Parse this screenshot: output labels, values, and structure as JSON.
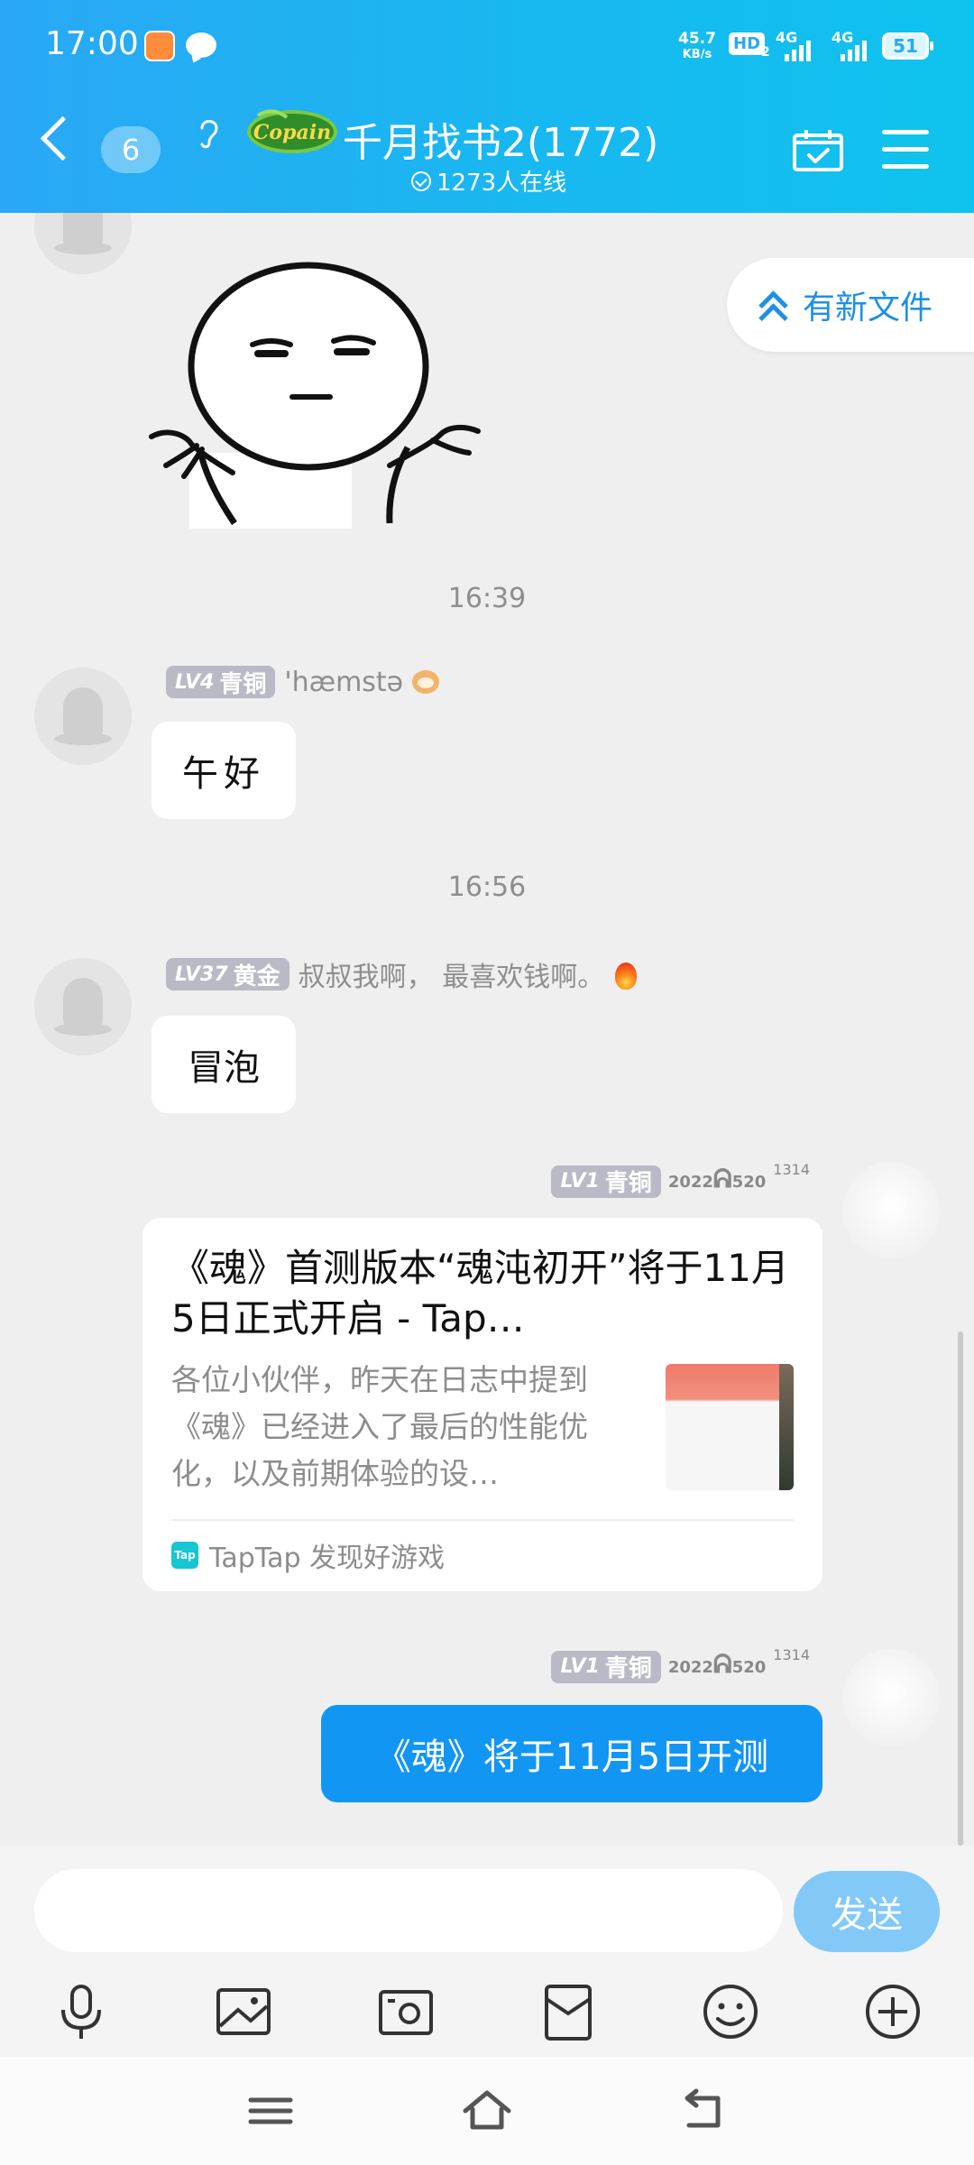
{
  "status_bar": {
    "time": "17:00",
    "net_speed_value": "45.7",
    "net_speed_unit": "KB/s",
    "hd_label": "HD",
    "hd_sub": "2",
    "signal1_label": "4G",
    "signal2_label": "4G",
    "battery": "51"
  },
  "header": {
    "unread_count": "6",
    "logo_text": "Copain",
    "group_title": "千月找书2(1772)",
    "online_text": "1273人在线",
    "icons": [
      "back-icon",
      "ear-icon",
      "calendar-check-icon",
      "menu-icon"
    ]
  },
  "banner": {
    "new_files_label": "有新文件"
  },
  "messages": {
    "time_1": "16:39",
    "msg1": {
      "level": "LV4",
      "rank": "青铜",
      "name": "'hæmstə",
      "text": "午好"
    },
    "time_2": "16:56",
    "msg2": {
      "level": "LV37",
      "rank": "黄金",
      "name": "叔叔我啊， 最喜欢钱啊。",
      "text": "冒泡"
    },
    "msg3": {
      "level": "LV1",
      "rank": "青铜",
      "name_main": "2022",
      "name_glyph": "ᕱ",
      "name_tail": "520",
      "name_sup": "1314",
      "card": {
        "title": "《魂》首测版本“魂沌初开”将于11月5日正式开启 - Tap…",
        "description": "各位小伙伴，昨天在日志中提到《魂》已经进入了最后的性能优化，以及前期体验的设…",
        "source_icon_text": "Tap",
        "source": "TapTap 发现好游戏"
      }
    },
    "msg4": {
      "level": "LV1",
      "rank": "青铜",
      "name_main": "2022",
      "name_glyph": "ᕱ",
      "name_tail": "520",
      "name_sup": "1314",
      "text": "《魂》将于11月5日开测"
    }
  },
  "composer": {
    "input_value": "",
    "input_placeholder": "",
    "send_label": "发送",
    "tools": [
      "microphone-icon",
      "image-icon",
      "camera-icon",
      "red-packet-icon",
      "emoji-icon",
      "plus-icon"
    ]
  },
  "nav": {
    "buttons": [
      "recent-apps-icon",
      "home-icon",
      "back-nav-icon"
    ]
  },
  "colors": {
    "header_start": "#2aa8f5",
    "header_end": "#0fc3ee",
    "accent": "#1296f3",
    "send_disabled": "#82c9f7",
    "level_badge": "#b9bac6"
  }
}
